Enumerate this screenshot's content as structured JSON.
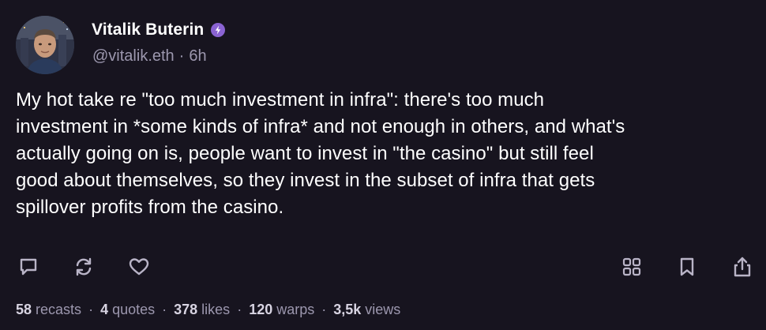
{
  "author": {
    "display_name": "Vitalik Buterin",
    "handle": "@vitalik.eth",
    "time_ago": "6h",
    "verified_badge_color": "#8a63d2"
  },
  "post": {
    "lines": [
      "My hot take re \"too much investment in infra\": there's too much",
      "investment in *some kinds of infra* and not enough in others, and what's",
      "actually going on is, people want to invest in \"the casino\" but still feel",
      "good about themselves, so they invest in the subset of infra that gets",
      "spillover profits from the casino."
    ]
  },
  "actions": {
    "left": [
      "reply-icon",
      "recast-icon",
      "like-icon"
    ],
    "right": [
      "grid-icon",
      "bookmark-icon",
      "share-icon"
    ]
  },
  "stats": {
    "recasts_count": "58",
    "recasts_label": "recasts",
    "quotes_count": "4",
    "quotes_label": "quotes",
    "likes_count": "378",
    "likes_label": "likes",
    "warps_count": "120",
    "warps_label": "warps",
    "views_count": "3,5k",
    "views_label": "views"
  },
  "colors": {
    "background": "#17141f",
    "text": "#ffffff",
    "muted": "#9c97ae",
    "icon": "#b9b4c7"
  }
}
